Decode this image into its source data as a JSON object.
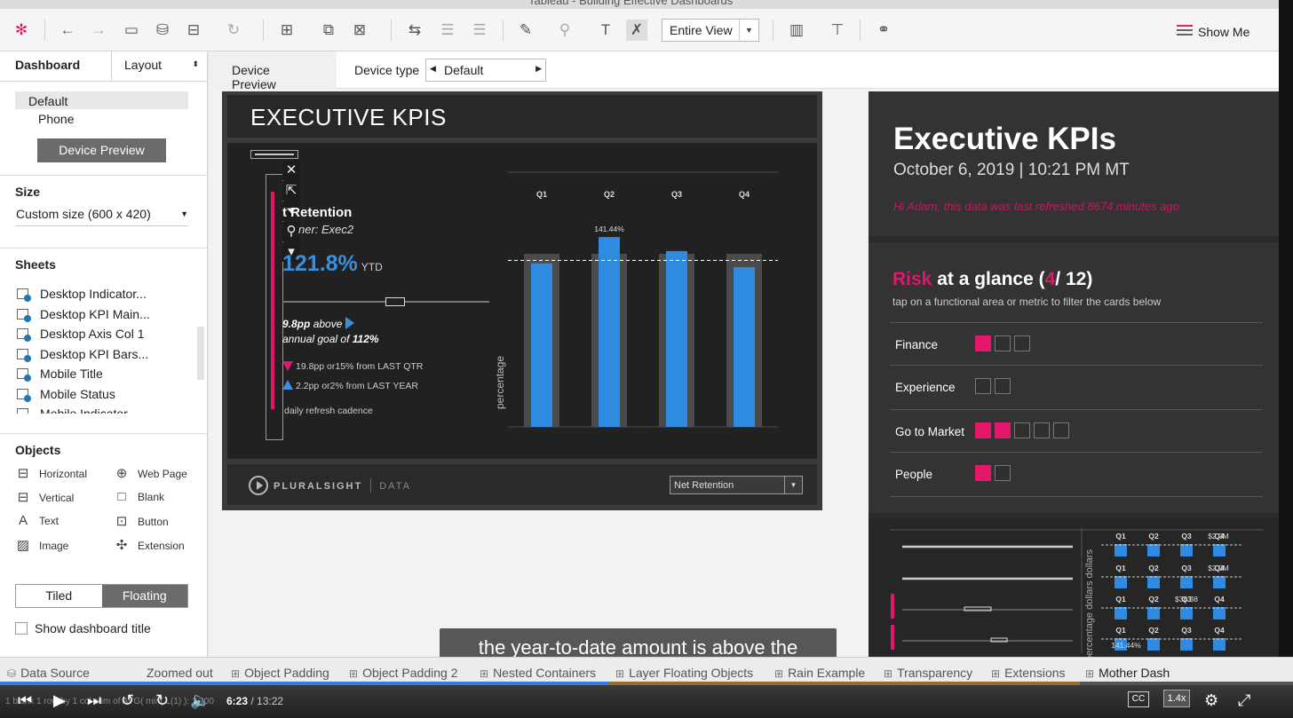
{
  "window": {
    "title": "Tableau - Building Effective Dashboards"
  },
  "toolbar": {
    "fit": "Entire View",
    "show_me": "Show Me"
  },
  "left_panel": {
    "tab_dashboard": "Dashboard",
    "tab_layout": "Layout",
    "devices": [
      "Default",
      "Phone"
    ],
    "device_preview_button": "Device Preview",
    "size_header": "Size",
    "size_value": "Custom size (600 x 420)",
    "sheets_header": "Sheets",
    "sheets": [
      "Desktop Indicator...",
      "Desktop KPI Main...",
      "Desktop Axis Col 1",
      "Desktop KPI Bars...",
      "Mobile Title",
      "Mobile Status",
      "Mobile Indicator..."
    ],
    "objects_header": "Objects",
    "objects": [
      {
        "label": "Horizontal",
        "icon": "horizontal-container-icon"
      },
      {
        "label": "Web Page",
        "icon": "globe-icon"
      },
      {
        "label": "Vertical",
        "icon": "vertical-container-icon"
      },
      {
        "label": "Blank",
        "icon": "blank-icon"
      },
      {
        "label": "Text",
        "icon": "text-icon"
      },
      {
        "label": "Button",
        "icon": "button-icon"
      },
      {
        "label": "Image",
        "icon": "image-icon"
      },
      {
        "label": "Extension",
        "icon": "puzzle-icon"
      }
    ],
    "tiled": "Tiled",
    "floating": "Floating",
    "show_title": "Show dashboard title"
  },
  "device_bar": {
    "device_preview": "Device Preview",
    "device_type_label": "Device type",
    "device_type_value": "Default"
  },
  "desktop_dash": {
    "header": "EXECUTIVE KPIS",
    "kpi_title": "t Retention",
    "kpi_owner": "ner: Exec2",
    "kpi_value": "121.8%",
    "kpi_ytd": "YTD",
    "above_value": "9.8pp",
    "above_text": "above",
    "goal_text": "annual goal of",
    "goal_value": "112%",
    "delta_qtr": "19.8pp or15% from LAST QTR",
    "delta_year": "2.2pp or2% from LAST YEAR",
    "refresh": "daily refresh cadence",
    "footer_brand": "PLURALSIGHT",
    "footer_data": "DATA",
    "footer_filter": "Net Retention"
  },
  "chart_data": {
    "type": "bar",
    "categories": [
      "Q1",
      "Q2",
      "Q3",
      "Q4"
    ],
    "values": [
      121.8,
      141.44,
      131,
      119
    ],
    "target": [
      129,
      129,
      129,
      129
    ],
    "ylabel": "percentage",
    "data_labels": [
      "",
      "141.44%",
      "",
      ""
    ],
    "reference_line": 124,
    "colors": {
      "bar": "#2f8be0",
      "target": "#4a4a4a",
      "line": "#ffffff"
    }
  },
  "mobile_dash": {
    "title": "Executive KPIs",
    "date": "October 6, 2019 | 10:21 PM MT",
    "refresh_note": "Hi Adam, this data was last refreshed 8674 minutes ago",
    "risk_word": "Risk",
    "risk_rest": "at a glance",
    "risk_paren_open": "(",
    "risk_count": "4",
    "risk_total": "/ 12)",
    "risk_sub": "tap on a functional area or metric to filter the cards below",
    "risk_rows": [
      {
        "label": "Finance",
        "squares": [
          1,
          0,
          0
        ]
      },
      {
        "label": "Experience",
        "squares": [
          0,
          0
        ]
      },
      {
        "label": "Go to Market",
        "squares": [
          1,
          1,
          0,
          0,
          0
        ]
      },
      {
        "label": "People",
        "squares": [
          1,
          0
        ]
      }
    ],
    "mini_q": [
      "Q1",
      "Q2",
      "Q3",
      "Q4"
    ],
    "mini_labels": [
      "$2.0M",
      "$2.0M",
      "$36.38",
      "141.44%"
    ],
    "mini_axis": "percentage dollars dollars"
  },
  "subtitle": "the year-to-date amount is above the",
  "sheet_tabs": [
    "Data Source",
    "Zoomed out",
    "Object Padding",
    "Object Padding 2",
    "Nested Containers",
    "Layer Floating Objects",
    "Rain Example",
    "Transparency",
    "Extensions",
    "Mother Dash"
  ],
  "player": {
    "time_current": "6:23",
    "time_total": "/ 13:22",
    "speed": "1.4x",
    "cc": "CC",
    "status": "1 blank   1 row by 1 col   sum of AVG( min( L(1) ): 1.000"
  },
  "colors": {
    "accent": "#e2166b",
    "blue": "#2f8be0"
  }
}
